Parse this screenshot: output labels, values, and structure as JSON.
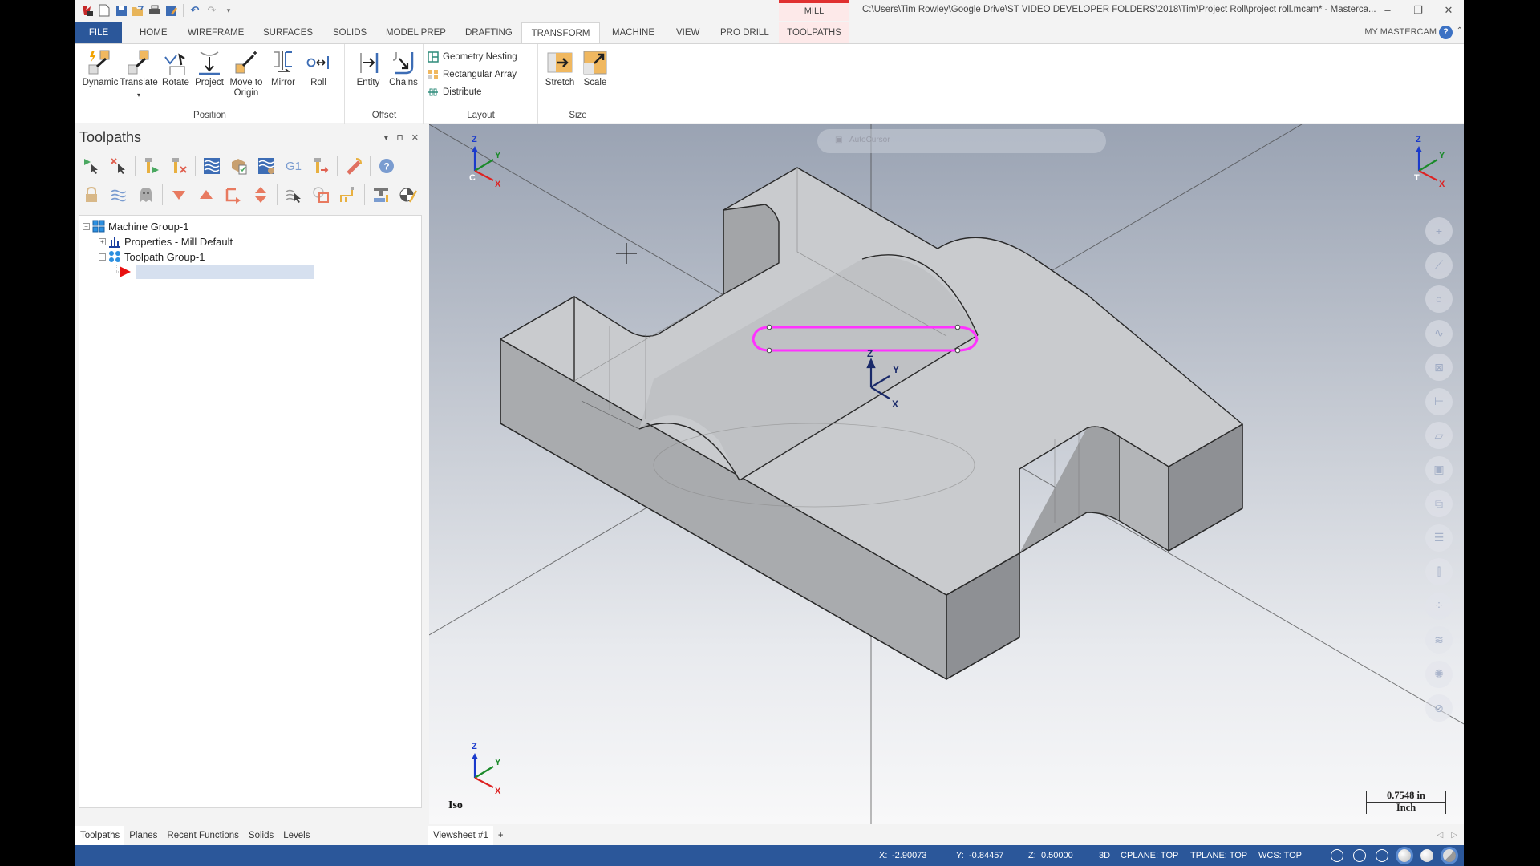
{
  "window": {
    "title": "C:\\Users\\Tim Rowley\\Google Drive\\ST VIDEO DEVELOPER FOLDERS\\2018\\Tim\\Project Roll\\project roll.mcam* - Masterca...",
    "context_tab_group": "MILL",
    "minimize": "–",
    "restore": "❐",
    "close": "✕"
  },
  "quick_access": [
    "app-logo-icon",
    "new-file-icon",
    "save-icon",
    "open-icon",
    "print-icon",
    "save-as-icon",
    "undo-icon",
    "redo-icon",
    "customize-icon"
  ],
  "tabs": [
    {
      "label": "FILE"
    },
    {
      "label": "HOME"
    },
    {
      "label": "WIREFRAME"
    },
    {
      "label": "SURFACES"
    },
    {
      "label": "SOLIDS"
    },
    {
      "label": "MODEL PREP"
    },
    {
      "label": "DRAFTING"
    },
    {
      "label": "TRANSFORM"
    },
    {
      "label": "MACHINE"
    },
    {
      "label": "VIEW"
    },
    {
      "label": "PRO DRILL"
    },
    {
      "label": "TOOLPATHS"
    }
  ],
  "active_tab": "TRANSFORM",
  "my_mastercam": "MY MASTERCAM",
  "help": "?",
  "ribbon": {
    "position": {
      "label": "Position",
      "buttons": [
        {
          "label": "Dynamic",
          "icon": "dynamic-icon"
        },
        {
          "label": "Translate",
          "icon": "translate-icon",
          "dropdown": "▾"
        },
        {
          "label": "Rotate",
          "icon": "rotate-icon"
        },
        {
          "label": "Project",
          "icon": "project-icon"
        },
        {
          "label": "Move to",
          "label2": "Origin",
          "icon": "move-to-origin-icon"
        },
        {
          "label": "Mirror",
          "icon": "mirror-icon"
        },
        {
          "label": "Roll",
          "icon": "roll-icon"
        }
      ]
    },
    "offset": {
      "label": "Offset",
      "buttons": [
        {
          "label": "Entity",
          "icon": "offset-entity-icon"
        },
        {
          "label": "Chains",
          "icon": "offset-chains-icon"
        }
      ]
    },
    "layout": {
      "label": "Layout",
      "buttons": [
        {
          "label": "Geometry Nesting",
          "icon": "geometry-nesting-icon"
        },
        {
          "label": "Rectangular Array",
          "icon": "rectangular-array-icon"
        },
        {
          "label": "Distribute",
          "icon": "distribute-icon"
        }
      ]
    },
    "size": {
      "label": "Size",
      "buttons": [
        {
          "label": "Stretch",
          "icon": "stretch-icon"
        },
        {
          "label": "Scale",
          "icon": "scale-icon"
        }
      ]
    }
  },
  "toolpaths_panel": {
    "title": "Toolpaths",
    "controls": {
      "dropdown": "▾",
      "pin": "⊓",
      "close": "✕"
    },
    "toolbar_row1": [
      "select-all-operations-icon",
      "deselect-operations-icon",
      "regenerate-selected-icon",
      "regenerate-dirty-icon",
      "backplot-icon",
      "verify-icon",
      "simulate-icon",
      "post-g1-icon",
      "highfeed-icon",
      "delete-toolpaths-icon",
      "help-icon"
    ],
    "toolbar_row1_g1": "G1",
    "toolbar_row2": [
      "lock-icon",
      "toggle-display-icon",
      "ghost-icon",
      "move-down-icon",
      "move-up-icon",
      "insert-arrow-icon",
      "scroll-to-insert-icon",
      "toolpath-select-icon",
      "only-display-selected-icon",
      "tool-display-icon",
      "machine-sim-icon",
      "stock-model-icon"
    ],
    "tree": [
      {
        "label": "Machine Group-1",
        "expander": "−",
        "icon": "machine-group-icon"
      },
      {
        "label": "Properties - Mill Default",
        "expander": "+",
        "icon": "properties-icon"
      },
      {
        "label": "Toolpath Group-1",
        "expander": "−",
        "icon": "toolpath-group-icon"
      },
      {
        "label": "",
        "icon": "insert-arrow-icon",
        "editing": true
      }
    ]
  },
  "panel_tabs": [
    {
      "label": "Toolpaths",
      "active": true
    },
    {
      "label": "Planes"
    },
    {
      "label": "Recent Functions"
    },
    {
      "label": "Solids"
    },
    {
      "label": "Levels"
    }
  ],
  "viewsheet_tabs": [
    {
      "label": "Viewsheet #1",
      "active": true
    },
    {
      "label": "+"
    }
  ],
  "viewport": {
    "view_name": "Iso",
    "scale_value": "0.7548 in",
    "scale_unit": "Inch",
    "selection_bar": {
      "autocursor": "AutoCursor"
    },
    "gnomon_labels": {
      "x": "X",
      "y": "Y",
      "z": "Z",
      "c": "C",
      "t": "T"
    },
    "highlight_color": "#ff33ff",
    "right_toolbar": [
      "point-icon",
      "line-icon",
      "circle-icon",
      "spline-icon",
      "solid-icon",
      "dimension-icon",
      "surface-icon",
      "box-icon",
      "transform-icon",
      "toolpath-list-icon",
      "drill-icon",
      "chain-icon",
      "levels-icon",
      "settings-icon",
      "clear-color-icon"
    ]
  },
  "statusbar": {
    "x_label": "X:",
    "x": "-2.90073",
    "y_label": "Y:",
    "y": "-0.84457",
    "z_label": "Z:",
    "z": "0.50000",
    "mode": "3D",
    "cplane": "CPLANE: TOP",
    "tplane": "TPLANE: TOP",
    "wcs": "WCS: TOP",
    "icons": [
      "wireframe-globe-icon",
      "hidden-globe-icon",
      "half-globe-icon",
      "shaded-sphere-icon",
      "flat-sphere-icon",
      "translucency-icon"
    ]
  },
  "colors": {
    "file_tab": "#2b579a",
    "status_bar": "#2b579a",
    "context_accent": "#e03030",
    "selection_chain": "#ff33ff"
  }
}
